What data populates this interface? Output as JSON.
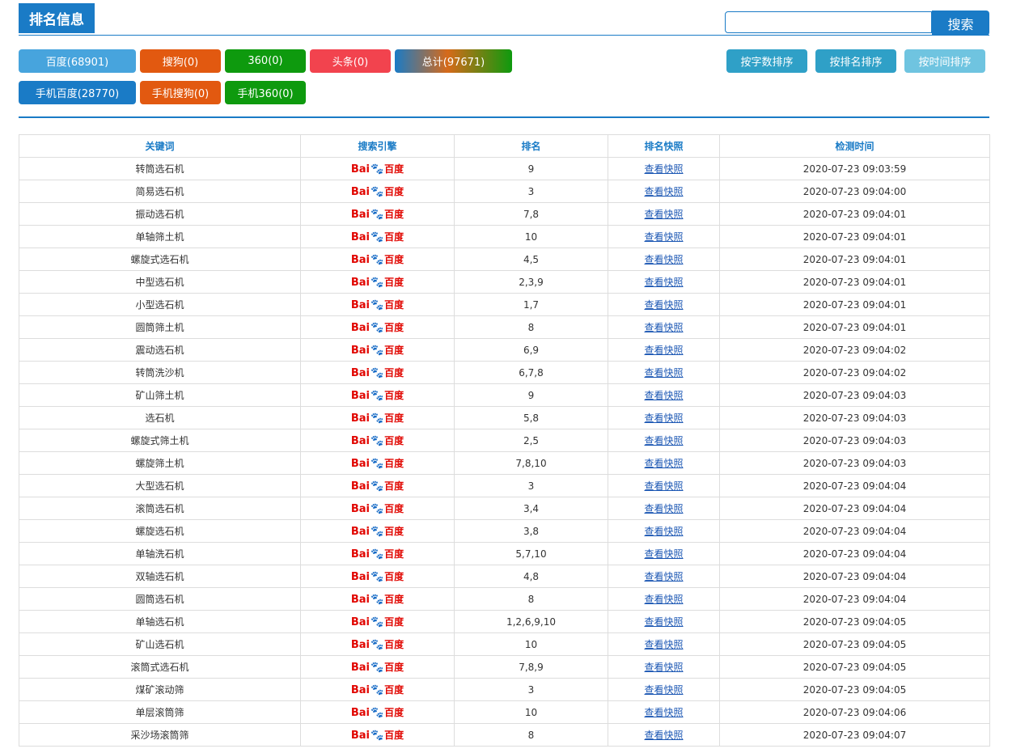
{
  "header": {
    "title": "排名信息",
    "search_button": "搜索",
    "search_value": ""
  },
  "filters": [
    {
      "label": "百度(68901)",
      "color": "#47a4dd"
    },
    {
      "label": "搜狗(0)",
      "color": "#e25910"
    },
    {
      "label": "360(0)",
      "color": "#0e9a0e"
    },
    {
      "label": "头条(0)",
      "color": "#f2434e"
    },
    {
      "label": "总计(97671)",
      "color": "gradient-blue-orange-green"
    },
    {
      "label": "手机百度(28770)",
      "color": "#1a7bc6"
    },
    {
      "label": "手机搜狗(0)",
      "color": "#e25910"
    },
    {
      "label": "手机360(0)",
      "color": "#0e9a0e"
    }
  ],
  "sort_buttons": [
    {
      "label": "按字数排序",
      "color": "#2fa0c7"
    },
    {
      "label": "按排名排序",
      "color": "#2fa0c7"
    },
    {
      "label": "按时间排序",
      "color": "#6fc4e0"
    }
  ],
  "table": {
    "headers": [
      "关键词",
      "搜索引擎",
      "排名",
      "排名快照",
      "检测时间"
    ],
    "engine_logo": {
      "latin": "Bai",
      "chinese": "百度",
      "icon": "baidu-paw-icon"
    },
    "snapshot_link": "查看快照",
    "rows": [
      {
        "keyword": "转筒选石机",
        "rank": "9",
        "time": "2020-07-23 09:03:59"
      },
      {
        "keyword": "简易选石机",
        "rank": "3",
        "time": "2020-07-23 09:04:00"
      },
      {
        "keyword": "振动选石机",
        "rank": "7,8",
        "time": "2020-07-23 09:04:01"
      },
      {
        "keyword": "单轴筛土机",
        "rank": "10",
        "time": "2020-07-23 09:04:01"
      },
      {
        "keyword": "螺旋式选石机",
        "rank": "4,5",
        "time": "2020-07-23 09:04:01"
      },
      {
        "keyword": "中型选石机",
        "rank": "2,3,9",
        "time": "2020-07-23 09:04:01"
      },
      {
        "keyword": "小型选石机",
        "rank": "1,7",
        "time": "2020-07-23 09:04:01"
      },
      {
        "keyword": "圆筒筛土机",
        "rank": "8",
        "time": "2020-07-23 09:04:01"
      },
      {
        "keyword": "震动选石机",
        "rank": "6,9",
        "time": "2020-07-23 09:04:02"
      },
      {
        "keyword": "转筒洗沙机",
        "rank": "6,7,8",
        "time": "2020-07-23 09:04:02"
      },
      {
        "keyword": "矿山筛土机",
        "rank": "9",
        "time": "2020-07-23 09:04:03"
      },
      {
        "keyword": "选石机",
        "rank": "5,8",
        "time": "2020-07-23 09:04:03"
      },
      {
        "keyword": "螺旋式筛土机",
        "rank": "2,5",
        "time": "2020-07-23 09:04:03"
      },
      {
        "keyword": "螺旋筛土机",
        "rank": "7,8,10",
        "time": "2020-07-23 09:04:03"
      },
      {
        "keyword": "大型选石机",
        "rank": "3",
        "time": "2020-07-23 09:04:04"
      },
      {
        "keyword": "滚筒选石机",
        "rank": "3,4",
        "time": "2020-07-23 09:04:04"
      },
      {
        "keyword": "螺旋选石机",
        "rank": "3,8",
        "time": "2020-07-23 09:04:04"
      },
      {
        "keyword": "单轴洗石机",
        "rank": "5,7,10",
        "time": "2020-07-23 09:04:04"
      },
      {
        "keyword": "双轴选石机",
        "rank": "4,8",
        "time": "2020-07-23 09:04:04"
      },
      {
        "keyword": "圆筒选石机",
        "rank": "8",
        "time": "2020-07-23 09:04:04"
      },
      {
        "keyword": "单轴选石机",
        "rank": "1,2,6,9,10",
        "time": "2020-07-23 09:04:05"
      },
      {
        "keyword": "矿山选石机",
        "rank": "10",
        "time": "2020-07-23 09:04:05"
      },
      {
        "keyword": "滚筒式选石机",
        "rank": "7,8,9",
        "time": "2020-07-23 09:04:05"
      },
      {
        "keyword": "煤矿滚动筛",
        "rank": "3",
        "time": "2020-07-23 09:04:05"
      },
      {
        "keyword": "单层滚筒筛",
        "rank": "10",
        "time": "2020-07-23 09:04:06"
      },
      {
        "keyword": "采沙场滚筒筛",
        "rank": "8",
        "time": "2020-07-23 09:04:07"
      }
    ]
  }
}
